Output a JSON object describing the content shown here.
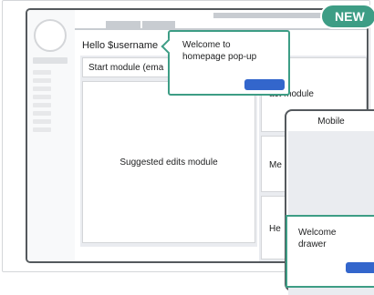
{
  "colors": {
    "accent": "#3d9d85",
    "primary_button": "#3366cc",
    "frame": "#54595d",
    "placeholder": "#c8ccd1",
    "module_bg": "#eaecf0"
  },
  "badge": {
    "label": "NEW"
  },
  "header": {
    "greeting": "Hello $username"
  },
  "modules": {
    "start": "Start module (ema",
    "suggested_edits": "Suggested edits module",
    "impact": "act module",
    "mentor": "Me",
    "help": "He"
  },
  "popup": {
    "text": "Welcome to homepage pop-up"
  },
  "mobile": {
    "title": "Mobile",
    "drawer_text": "Welcome drawer"
  }
}
